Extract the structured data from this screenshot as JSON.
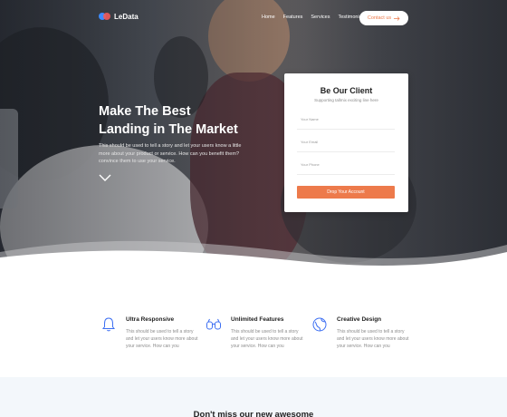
{
  "brand": {
    "name": "LeData",
    "colors": {
      "accent": "#ed7a4b",
      "logo_blue": "#3d8bfd",
      "logo_red": "#f05a5b"
    }
  },
  "nav": {
    "links": [
      "Home",
      "Features",
      "Services",
      "Testimonials"
    ],
    "contact_label": "Contact us",
    "contact_icon": "arrow-right-icon"
  },
  "hero": {
    "title_line1": "Make The Best",
    "title_line2": "Landing in The Market",
    "description": "This should be used to tell a story and let your users know a little more about your product or service. How can you benefit them? convince them to use your service.",
    "scroll_icon": "chevron-down-icon"
  },
  "form": {
    "title": "Be Our Client",
    "subtitle": "Supporting tallmix exciting line here",
    "fields": [
      {
        "placeholder": "Your Name"
      },
      {
        "placeholder": "Your Email"
      },
      {
        "placeholder": "Your Phone"
      }
    ],
    "submit_label": "Drop Your Account"
  },
  "features": [
    {
      "icon": "bell-icon",
      "title": "Ultra Responsive",
      "description": "This should be used to tell a story and let your users know more about your service. How can you"
    },
    {
      "icon": "glasses-icon",
      "title": "Unlimited Features",
      "description": "This should be used to tell a story and let your users know more about your service. How can you"
    },
    {
      "icon": "globe-icon",
      "title": "Creative Design",
      "description": "This should be used to tell a story and let your users know more about your service. How can you"
    }
  ],
  "newsletter": {
    "title": "Don't miss our new awesome"
  }
}
